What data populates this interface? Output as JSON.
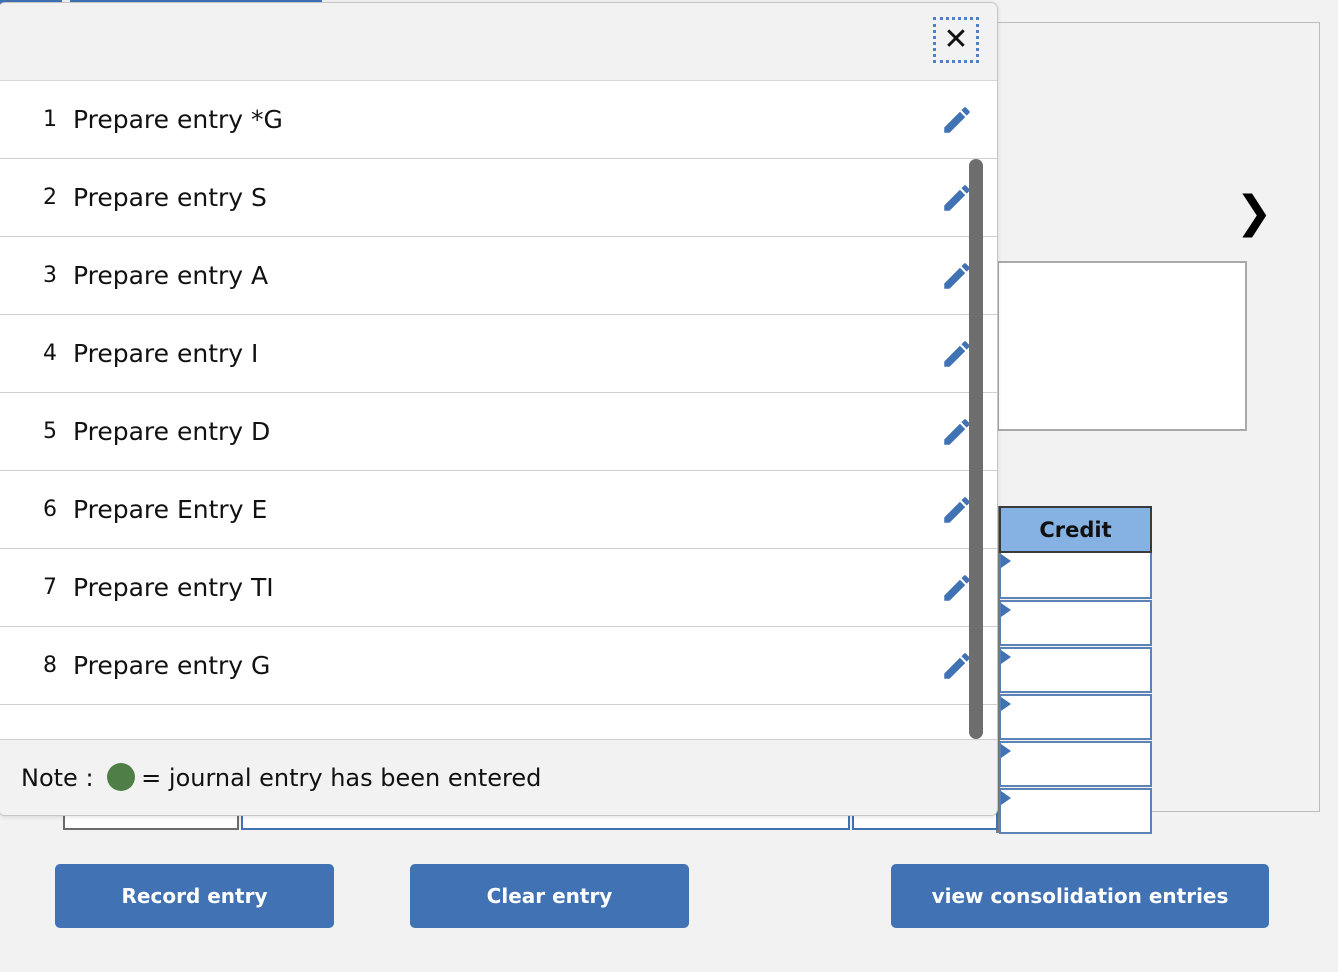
{
  "background": {
    "tabs": [
      {
        "name": "tab-left-partial",
        "label": ""
      },
      {
        "name": "tab-right-partial",
        "label": ""
      }
    ],
    "chevron_right_icon": "❯",
    "credit_column": {
      "header": "Credit",
      "cells": [
        "",
        "",
        "",
        "",
        "",
        ""
      ]
    },
    "form_fields": [
      {
        "name": "field-small-left",
        "value": ""
      },
      {
        "name": "field-wide-middle",
        "value": ""
      },
      {
        "name": "field-small-right",
        "value": ""
      }
    ]
  },
  "buttons": {
    "record_entry": "Record entry",
    "clear_entry": "Clear entry",
    "view_consolidation_entries": "view consolidation entries"
  },
  "modal": {
    "close_label": "✕",
    "entries": [
      {
        "num": "1",
        "label": "Prepare entry *G"
      },
      {
        "num": "2",
        "label": "Prepare entry S"
      },
      {
        "num": "3",
        "label": "Prepare entry A"
      },
      {
        "num": "4",
        "label": "Prepare entry I"
      },
      {
        "num": "5",
        "label": "Prepare entry D"
      },
      {
        "num": "6",
        "label": "Prepare Entry E"
      },
      {
        "num": "7",
        "label": "Prepare entry TI"
      },
      {
        "num": "8",
        "label": "Prepare entry G"
      }
    ],
    "note": {
      "prefix": "Note : ",
      "suffix": "= journal entry has been entered"
    }
  },
  "colors": {
    "accent_blue": "#4072b4",
    "credit_header_blue": "#85b2e3",
    "note_green": "#4f7f47",
    "page_bg": "#f2f2f2",
    "scrollbar_thumb": "#6e6e6e"
  }
}
